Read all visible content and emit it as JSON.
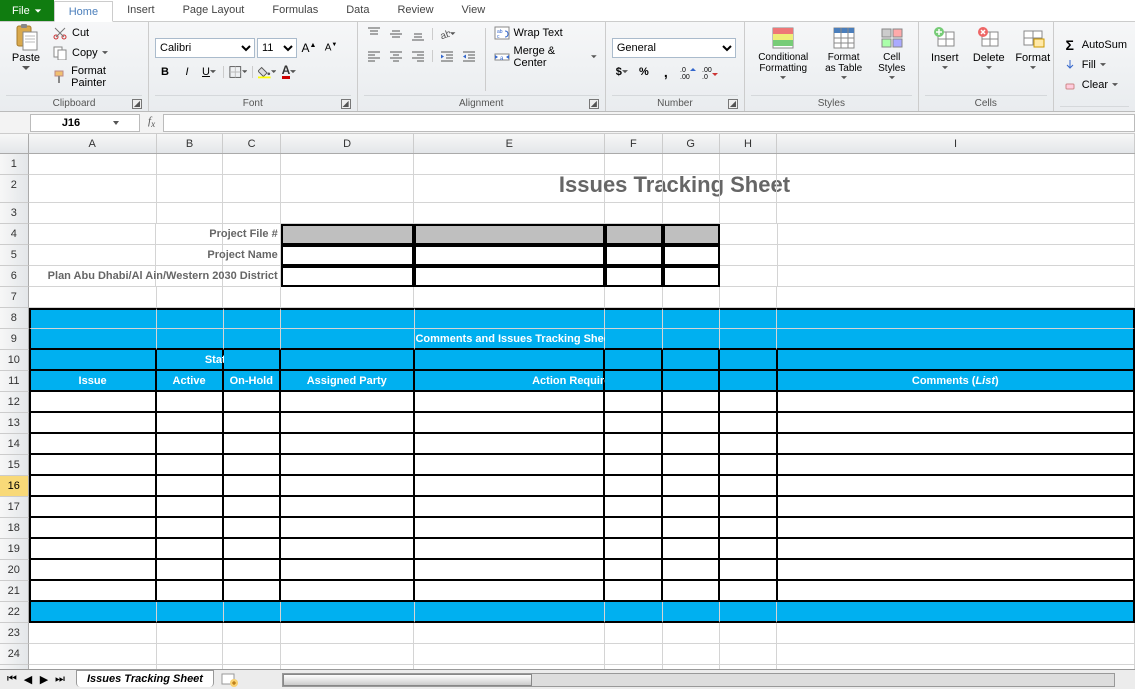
{
  "tabs": {
    "file": "File",
    "home": "Home",
    "insert": "Insert",
    "pagelayout": "Page Layout",
    "formulas": "Formulas",
    "data": "Data",
    "review": "Review",
    "view": "View"
  },
  "clipboard": {
    "paste": "Paste",
    "cut": "Cut",
    "copy": "Copy",
    "fmtpaint": "Format Painter",
    "group": "Clipboard"
  },
  "font": {
    "family": "Calibri",
    "size": "11",
    "bold": "B",
    "italic": "I",
    "underline": "U",
    "group": "Font"
  },
  "align": {
    "wrap": "Wrap Text",
    "merge": "Merge & Center",
    "group": "Alignment"
  },
  "number": {
    "fmt": "General",
    "group": "Number"
  },
  "styles": {
    "cond": "Conditional Formatting",
    "table": "Format as Table",
    "cell": "Cell Styles",
    "group": "Styles"
  },
  "cells": {
    "insert": "Insert",
    "delete": "Delete",
    "format": "Format",
    "group": "Cells"
  },
  "editing": {
    "autosum": "AutoSum",
    "fill": "Fill",
    "clear": "Clear"
  },
  "namebox": "J16",
  "cols": [
    "A",
    "B",
    "C",
    "D",
    "E",
    "F",
    "G",
    "H",
    "I"
  ],
  "sheet": {
    "title": "Issues Tracking Sheet",
    "lbl_file": "Project File #",
    "lbl_name": "Project Name",
    "lbl_district": "Plan Abu Dhabi/Al Ain/Western 2030 District",
    "banner": "Comments and Issues Tracking Sheet",
    "th_issue": "Issue",
    "th_status": "Status",
    "th_active": "Active",
    "th_hold": "On-Hold",
    "th_party": "Assigned Party",
    "th_action": "Action Required",
    "th_comments_a": "Comments (",
    "th_comments_b": "List",
    "th_comments_c": ")"
  },
  "sheettab": "Issues Tracking Sheet"
}
